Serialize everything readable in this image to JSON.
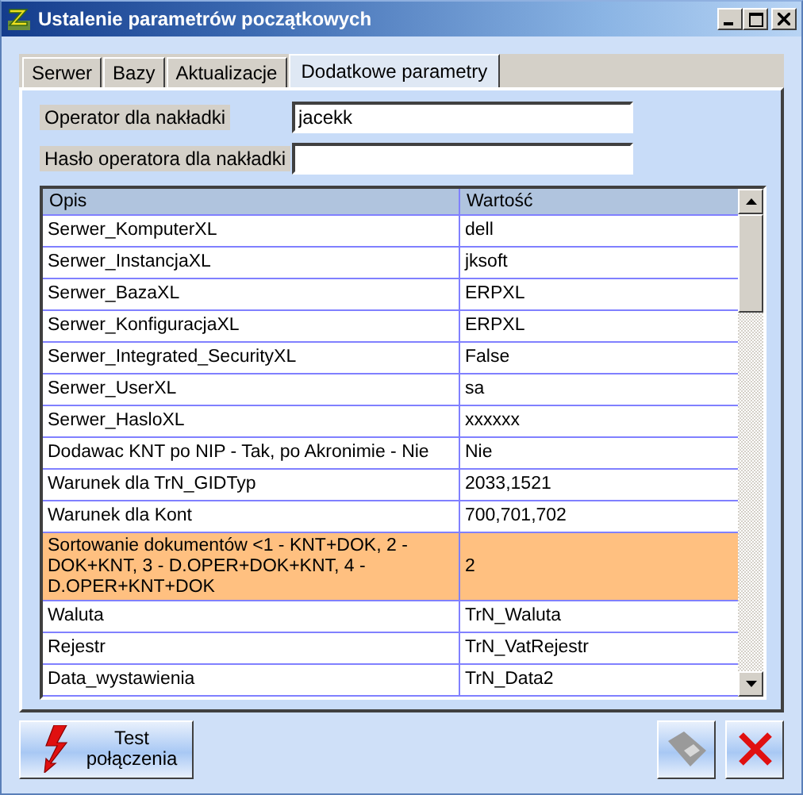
{
  "window": {
    "title": "Ustalenie parametrów początkowych"
  },
  "tabs": [
    {
      "label": "Serwer",
      "selected": false
    },
    {
      "label": "Bazy",
      "selected": false
    },
    {
      "label": "Aktualizacje",
      "selected": false
    },
    {
      "label": "Dodatkowe parametry",
      "selected": true
    }
  ],
  "fields": [
    {
      "label": "Operator dla nakładki",
      "value": "jacekk"
    },
    {
      "label": "Hasło operatora dla nakładki"
    }
  ],
  "table": {
    "columns": [
      "Opis",
      "Wartość"
    ],
    "rows": [
      {
        "opis": "Serwer_KomputerXL",
        "wartosc": "dell",
        "selected": false
      },
      {
        "opis": "Serwer_InstancjaXL",
        "wartosc": "jksoft",
        "selected": false
      },
      {
        "opis": "Serwer_BazaXL",
        "wartosc": "ERPXL",
        "selected": false
      },
      {
        "opis": "Serwer_KonfiguracjaXL",
        "wartosc": "ERPXL",
        "selected": false
      },
      {
        "opis": "Serwer_Integrated_SecurityXL",
        "wartosc": "False",
        "selected": false
      },
      {
        "opis": "Serwer_UserXL",
        "wartosc": "sa",
        "selected": false
      },
      {
        "opis": "Serwer_HasloXL",
        "wartosc": "xxxxxx",
        "selected": false
      },
      {
        "opis": "Dodawac KNT po NIP - Tak, po Akronimie - Nie",
        "wartosc": "Nie",
        "selected": false
      },
      {
        "opis": "Warunek dla TrN_GIDTyp",
        "wartosc": "2033,1521",
        "selected": false
      },
      {
        "opis": "Warunek dla Kont",
        "wartosc": "700,701,702",
        "selected": false
      },
      {
        "opis": "Sortowanie dokumentów <1 - KNT+DOK, 2 - DOK+KNT, 3 - D.OPER+DOK+KNT, 4 - D.OPER+KNT+DOK",
        "wartosc": "2",
        "selected": true
      },
      {
        "opis": "Waluta",
        "wartosc": "TrN_Waluta",
        "selected": false
      },
      {
        "opis": "Rejestr",
        "wartosc": "TrN_VatRejestr",
        "selected": false
      },
      {
        "opis": "Data_wystawienia",
        "wartosc": "TrN_Data2",
        "selected": false
      }
    ]
  },
  "buttons": [
    {
      "kind": "test",
      "label": "Test połączenia",
      "disabled": false
    },
    {
      "kind": "save",
      "disabled": true
    },
    {
      "kind": "close",
      "disabled": false
    }
  ]
}
